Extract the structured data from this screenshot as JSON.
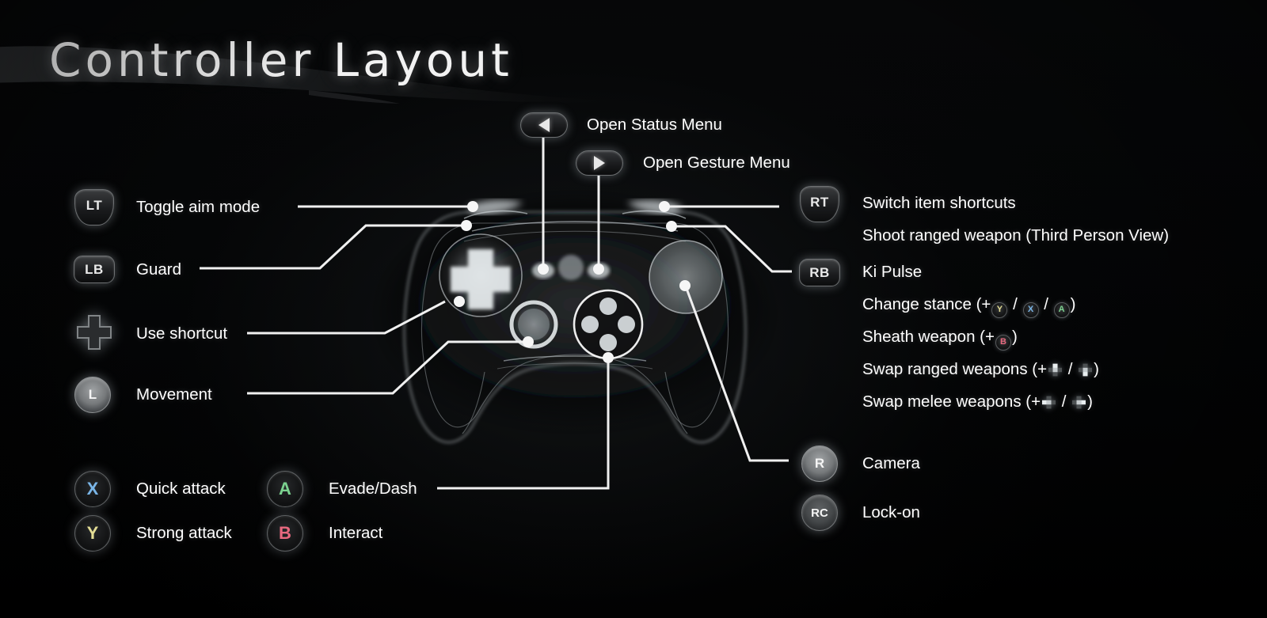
{
  "page": {
    "title": "Controller Layout",
    "background_color": "#050607",
    "text_color": "#ffffff"
  },
  "colors": {
    "button_x": "#7ab6e8",
    "button_y": "#e3dd94",
    "button_a": "#7bd18f",
    "button_b": "#e8697f",
    "leader_line": "#f0f0f0",
    "glow": "#cfd8dd"
  },
  "menu_buttons": [
    {
      "icon": "triangle-left-icon",
      "button": "back",
      "label": "Open Status Menu"
    },
    {
      "icon": "triangle-right-icon",
      "button": "start",
      "label": "Open Gesture Menu"
    }
  ],
  "left_column": [
    {
      "button": "LT",
      "icon": "trigger-icon",
      "label": "Toggle aim mode"
    },
    {
      "button": "LB",
      "icon": "bumper-icon",
      "label": "Guard"
    },
    {
      "button": "D-Pad",
      "icon": "dpad-icon",
      "label": "Use shortcut"
    },
    {
      "button": "L",
      "icon": "left-stick-icon",
      "label": "Movement"
    }
  ],
  "face_buttons": [
    {
      "button": "X",
      "color": "#7ab6e8",
      "label": "Quick attack"
    },
    {
      "button": "Y",
      "color": "#e3dd94",
      "label": "Strong attack"
    },
    {
      "button": "A",
      "color": "#7bd18f",
      "label": "Evade/Dash"
    },
    {
      "button": "B",
      "color": "#e8697f",
      "label": "Interact"
    }
  ],
  "right_column": [
    {
      "button": "RT",
      "icon": "trigger-icon",
      "lines": [
        {
          "text": "Switch item shortcuts"
        },
        {
          "text": "Shoot ranged weapon (Third Person View)"
        }
      ]
    },
    {
      "button": "RB",
      "icon": "bumper-icon",
      "lines": [
        {
          "text": "Ki Pulse"
        },
        {
          "prefix": "Change stance (+",
          "suffix": ")",
          "glyphs": [
            {
              "type": "face",
              "key": "Y",
              "color": "#e3dd94"
            },
            {
              "type": "sep",
              "key": "/"
            },
            {
              "type": "face",
              "key": "X",
              "color": "#7ab6e8"
            },
            {
              "type": "sep",
              "key": "/"
            },
            {
              "type": "face",
              "key": "A",
              "color": "#7bd18f"
            }
          ]
        },
        {
          "prefix": "Sheath weapon (+",
          "suffix": ")",
          "glyphs": [
            {
              "type": "face",
              "key": "B",
              "color": "#e8697f"
            }
          ]
        },
        {
          "prefix": "Swap ranged weapons (+",
          "suffix": ")",
          "glyphs": [
            {
              "type": "dpad",
              "key": "up"
            },
            {
              "type": "sep",
              "key": "/"
            },
            {
              "type": "dpad",
              "key": "down"
            }
          ]
        },
        {
          "prefix": "Swap melee weapons (+",
          "suffix": ")",
          "glyphs": [
            {
              "type": "dpad",
              "key": "left"
            },
            {
              "type": "sep",
              "key": "/"
            },
            {
              "type": "dpad",
              "key": "right"
            }
          ]
        }
      ]
    },
    {
      "button": "R",
      "icon": "right-stick-icon",
      "lines": [
        {
          "text": "Camera"
        }
      ]
    },
    {
      "button": "RC",
      "icon": "right-stick-click-icon",
      "lines": [
        {
          "text": "Lock-on"
        }
      ]
    }
  ]
}
